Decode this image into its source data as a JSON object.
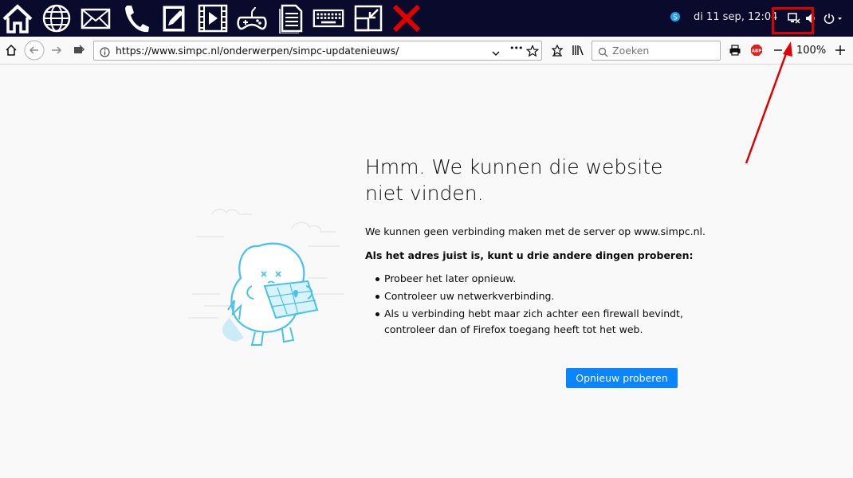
{
  "taskbar": {
    "apps": [
      {
        "name": "home-icon"
      },
      {
        "name": "globe-icon"
      },
      {
        "name": "mail-icon"
      },
      {
        "name": "phone-icon"
      },
      {
        "name": "notepad-icon"
      },
      {
        "name": "video-icon"
      },
      {
        "name": "gamepad-icon"
      },
      {
        "name": "document-icon"
      },
      {
        "name": "keyboard-icon"
      },
      {
        "name": "minimize-window-icon"
      },
      {
        "name": "close-x-icon"
      }
    ],
    "clock": "di 11 sep, 12:04",
    "colors": {
      "background": "#0a0a2c",
      "close_x": "#e00000",
      "highlight_box": "#e00000"
    }
  },
  "browser": {
    "url": "https://www.simpc.nl/onderwerpen/simpc-updatenieuws/",
    "search_placeholder": "Zoeken",
    "zoom": "100%",
    "adblock_label": "ABP",
    "url_dots": "•••"
  },
  "error_page": {
    "title": "Hmm. We kunnen die website niet vinden.",
    "description": "We kunnen geen verbinding maken met de server op www.simpc.nl.",
    "bold_line": "Als het adres juist is, kunt u drie andere dingen proberen:",
    "tips": [
      "Probeer het later opnieuw.",
      "Controleer uw netwerkverbinding.",
      "Als u verbinding hebt maar zich achter een firewall bevindt, controleer dan of Firefox toegang heeft tot het web."
    ],
    "retry_button": "Opnieuw proberen",
    "colors": {
      "button": "#0a84ff",
      "text": "#0c0c0d",
      "illustration": "#45c3ec"
    }
  },
  "annotation": {
    "arrow_color": "#e00000"
  }
}
